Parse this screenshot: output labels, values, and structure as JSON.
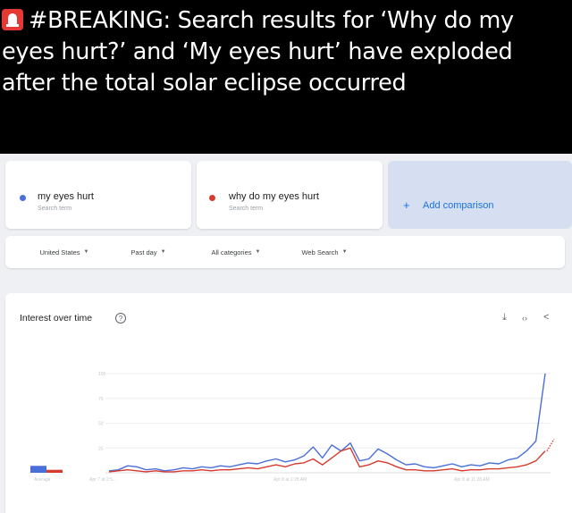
{
  "post": {
    "siren_icon": "police-siren-emoji",
    "hashtag": "#BREAKING",
    "text": ": Search results for ‘Why do my eyes hurt?’ and ‘My eyes hurt’ have exploded after the total solar eclipse occurred"
  },
  "colors": {
    "series_blue": "#4a6fd8",
    "series_red": "#d63b2f",
    "accent": "#1a73e8"
  },
  "search_terms": [
    {
      "name": "my eyes hurt",
      "sub": "Search term"
    },
    {
      "name": "why do my eyes hurt",
      "sub": "Search term"
    }
  ],
  "add_comparison": {
    "plus": "+",
    "label": "Add comparison"
  },
  "filters": [
    {
      "label": "United States"
    },
    {
      "label": "Past day"
    },
    {
      "label": "All categories"
    },
    {
      "label": "Web Search"
    }
  ],
  "interest": {
    "title": "Interest over time",
    "help_icon": "question-circle-icon",
    "tools": [
      "download-icon",
      "embed-icon",
      "share-icon"
    ],
    "tool_glyphs": {
      "download": "⤓",
      "embed": "‹›",
      "share": "<"
    }
  },
  "chart_data": {
    "type": "line",
    "title": "Interest over time",
    "yticks": [
      "100",
      "75",
      "50",
      "25"
    ],
    "ylim": [
      0,
      100
    ],
    "xticks": [
      "Apr 7 at 2:5...",
      "Apr 8 at 1:28 AM",
      "Apr 8 at 11:28 AM"
    ],
    "average_label": "Average",
    "average": [
      {
        "name": "my eyes hurt",
        "value": 7
      },
      {
        "name": "why do my eyes hurt",
        "value": 3
      }
    ],
    "series": [
      {
        "name": "my eyes hurt",
        "values": [
          2,
          3,
          7,
          6,
          3,
          4,
          2,
          3,
          5,
          4,
          6,
          5,
          7,
          6,
          8,
          10,
          9,
          12,
          14,
          11,
          13,
          17,
          26,
          15,
          28,
          22,
          30,
          12,
          14,
          24,
          19,
          13,
          8,
          9,
          6,
          5,
          7,
          9,
          6,
          8,
          7,
          10,
          9,
          13,
          15,
          22,
          32,
          100
        ]
      },
      {
        "name": "why do my eyes hurt",
        "values": [
          1,
          2,
          3,
          2,
          1,
          2,
          1,
          1,
          2,
          2,
          3,
          2,
          3,
          3,
          4,
          5,
          4,
          6,
          8,
          6,
          9,
          10,
          14,
          8,
          15,
          22,
          25,
          6,
          8,
          12,
          10,
          6,
          3,
          3,
          2,
          2,
          3,
          4,
          2,
          3,
          3,
          4,
          4,
          5,
          6,
          8,
          12,
          22
        ]
      }
    ]
  }
}
